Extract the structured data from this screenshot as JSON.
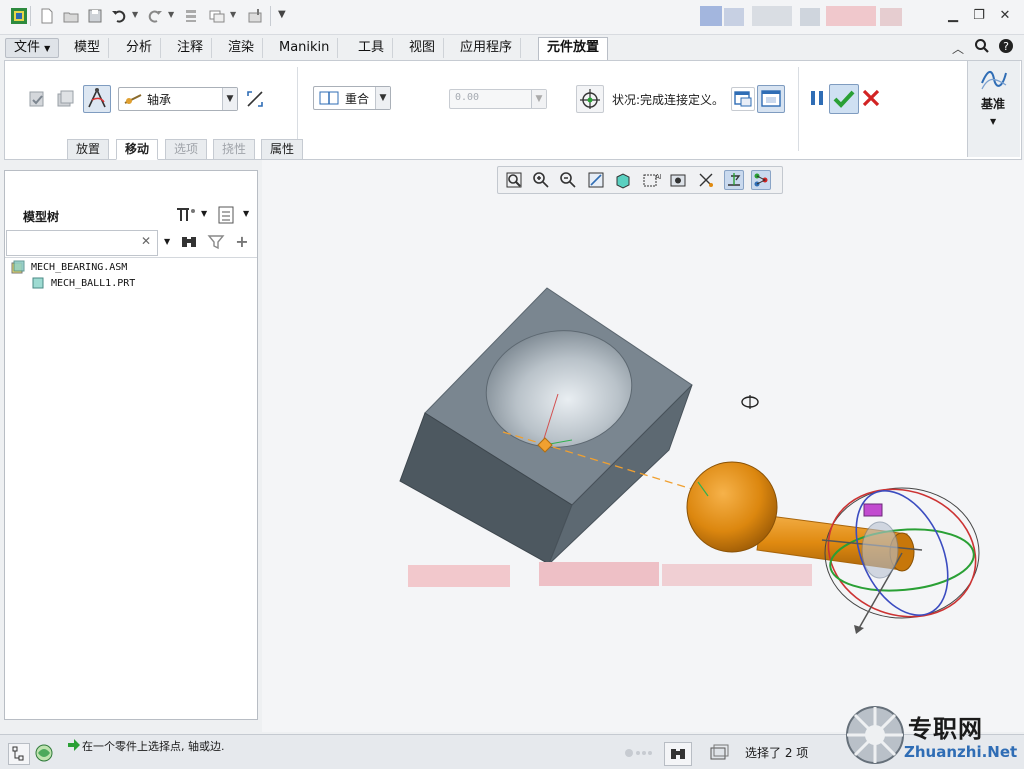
{
  "ribbon_tabs": [
    "文件",
    "模型",
    "分析",
    "注释",
    "渲染",
    "Manikin",
    "工具",
    "视图",
    "应用程序",
    "元件放置"
  ],
  "ribbon": {
    "constraint_set": "轴承",
    "constraint_type": "重合",
    "offset_value": "0.00",
    "status_text": "状况:完成连接定义。",
    "datum_label": "基准"
  },
  "sub_tabs": [
    "放置",
    "移动",
    "选项",
    "挠性",
    "属性"
  ],
  "left_panel": {
    "title": "模型树",
    "search_placeholder": "",
    "tree": [
      {
        "label": "MECH_BEARING.ASM",
        "level": 0
      },
      {
        "label": "MECH_BALL1.PRT",
        "level": 1
      }
    ]
  },
  "status": {
    "message": "在一个零件上选择点, 轴或边.",
    "selection": "选择了 2 项"
  },
  "watermark": {
    "brand_cn": "专职网",
    "brand_en": "Zhuanzhi.Net"
  },
  "colors": {
    "accent": "#2f6db5",
    "confirm": "#2aa035",
    "cancel": "#d22323",
    "part_gray": "#6e7a84",
    "part_orange": "#e08a10"
  },
  "icons": {
    "pause": "pause-icon",
    "confirm": "checkmark-icon",
    "cancel": "close-icon",
    "model_tree": "model-tree-icon",
    "layers": "layers-icon",
    "favorites": "folder-star-icon"
  }
}
